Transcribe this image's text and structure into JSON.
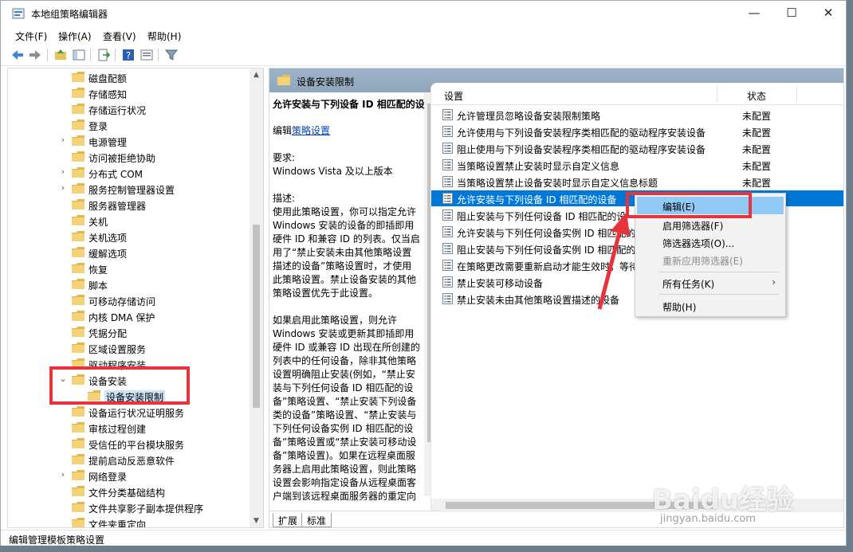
{
  "window": {
    "title": "本地组策略编辑器"
  },
  "menu": [
    "文件(F)",
    "操作(A)",
    "查看(V)",
    "帮助(H)"
  ],
  "tree": [
    {
      "label": "磁盘配额",
      "expand": false
    },
    {
      "label": "存储感知",
      "expand": false
    },
    {
      "label": "存储运行状况",
      "expand": false
    },
    {
      "label": "登录",
      "expand": false
    },
    {
      "label": "电源管理",
      "expand": true
    },
    {
      "label": "访问被拒绝协助",
      "expand": false
    },
    {
      "label": "分布式 COM",
      "expand": true
    },
    {
      "label": "服务控制管理器设置",
      "expand": true
    },
    {
      "label": "服务器管理器",
      "expand": false
    },
    {
      "label": "关机",
      "expand": false
    },
    {
      "label": "关机选项",
      "expand": false
    },
    {
      "label": "缓解选项",
      "expand": false
    },
    {
      "label": "恢复",
      "expand": false
    },
    {
      "label": "脚本",
      "expand": false
    },
    {
      "label": "可移动存储访问",
      "expand": false
    },
    {
      "label": "内核 DMA 保护",
      "expand": false
    },
    {
      "label": "凭据分配",
      "expand": false
    },
    {
      "label": "区域设置服务",
      "expand": false
    },
    {
      "label": "驱动程序安装",
      "expand": false
    },
    {
      "label": "设备安装",
      "expand": "open"
    },
    {
      "label": "设备安装限制",
      "expand": false,
      "child": true,
      "selected": true
    },
    {
      "label": "设备运行状况证明服务",
      "expand": false
    },
    {
      "label": "审核过程创建",
      "expand": false
    },
    {
      "label": "受信任的平台模块服务",
      "expand": false
    },
    {
      "label": "提前启动反恶意软件",
      "expand": false
    },
    {
      "label": "网络登录",
      "expand": true
    },
    {
      "label": "文件分类基础结构",
      "expand": false
    },
    {
      "label": "文件共享影子副本提供程序",
      "expand": false
    },
    {
      "label": "文件夹重定向",
      "expand": false
    }
  ],
  "header": {
    "folder_label": "设备安装限制"
  },
  "description": {
    "title": "允许安装与下列设备 ID 相匹配的设备",
    "edit_prefix": "编辑",
    "edit_link": "策略设置",
    "requirement_label": "要求:",
    "requirement_value": "Windows Vista 及以上版本",
    "desc_label": "描述:",
    "p1": "使用此策略设置，你可以指定允许 Windows 安装的设备的即插即用硬件 ID 和兼容 ID 的列表。仅当启用了“禁止安装未由其他策略设置描述的设备”策略设置时，才使用此策略设置。禁止设备安装的其他策略设置优先于此设置。",
    "p2": "如果启用此策略设置，则允许 Windows 安装或更新其即插即用硬件 ID 或兼容 ID 出现在所创建的列表中的任何设备，除非其他策略设置明确阻止安装(例如，“禁止安装与下列任何设备 ID 相匹配的设备”策略设置、“禁止安装下列设备类的设备”策略设置、“禁止安装与下列任何设备实例 ID 相匹配的设备”策略设置或“禁止安装可移动设备”策略设置)。如果在远程桌面服务器上启用此策略设置，则此策略设置会影响指定设备从远程桌面客户端到该远程桌面服务器的重定向"
  },
  "list": {
    "col_setting": "设置",
    "col_state": "状态",
    "rows": [
      {
        "name": "允许管理员忽略设备安装限制策略",
        "state": "未配置"
      },
      {
        "name": "允许使用与下列设备安装程序类相匹配的驱动程序安装设备",
        "state": "未配置"
      },
      {
        "name": "阻止使用与下列设备安装程序类相匹配的驱动程序安装设备",
        "state": "未配置"
      },
      {
        "name": "当策略设置禁止安装时显示自定义信息",
        "state": "未配置"
      },
      {
        "name": "当策略设置禁止设备安装时显示自定义信息标题",
        "state": "未配置"
      },
      {
        "name": "允许安装与下列设备 ID 相匹配的设备",
        "state": "",
        "selected": true
      },
      {
        "name": "阻止安装与下列任何设备 ID 相匹配的设",
        "state": ""
      },
      {
        "name": "允许安装与下列任何设备实例 ID 相匹配的",
        "state": ""
      },
      {
        "name": "阻止安装与下列任何设备实例 ID 相匹配的",
        "state": ""
      },
      {
        "name": "在策略更改需要重新启动才能生效时，等待",
        "state": ""
      },
      {
        "name": "禁止安装可移动设备",
        "state": ""
      },
      {
        "name": "禁止安装未由其他策略设置描述的设备",
        "state": ""
      }
    ]
  },
  "context_menu": {
    "edit": "编辑(E)",
    "enable_filter": "启用筛选器(F)",
    "filter_options": "筛选器选项(O)...",
    "reapply_filter": "重新应用筛选器(E)",
    "all_tasks": "所有任务(K)",
    "help": "帮助(H)"
  },
  "tabs": [
    "扩展",
    "标准"
  ],
  "status": {
    "text": "编辑管理模板策略设置"
  },
  "watermark": {
    "brand": "Baidu经验",
    "url": "jingyan.baidu.com"
  },
  "colors": {
    "selection": "#0078d7",
    "highlight_red": "#e8333c",
    "folder": "#e8c25a"
  }
}
